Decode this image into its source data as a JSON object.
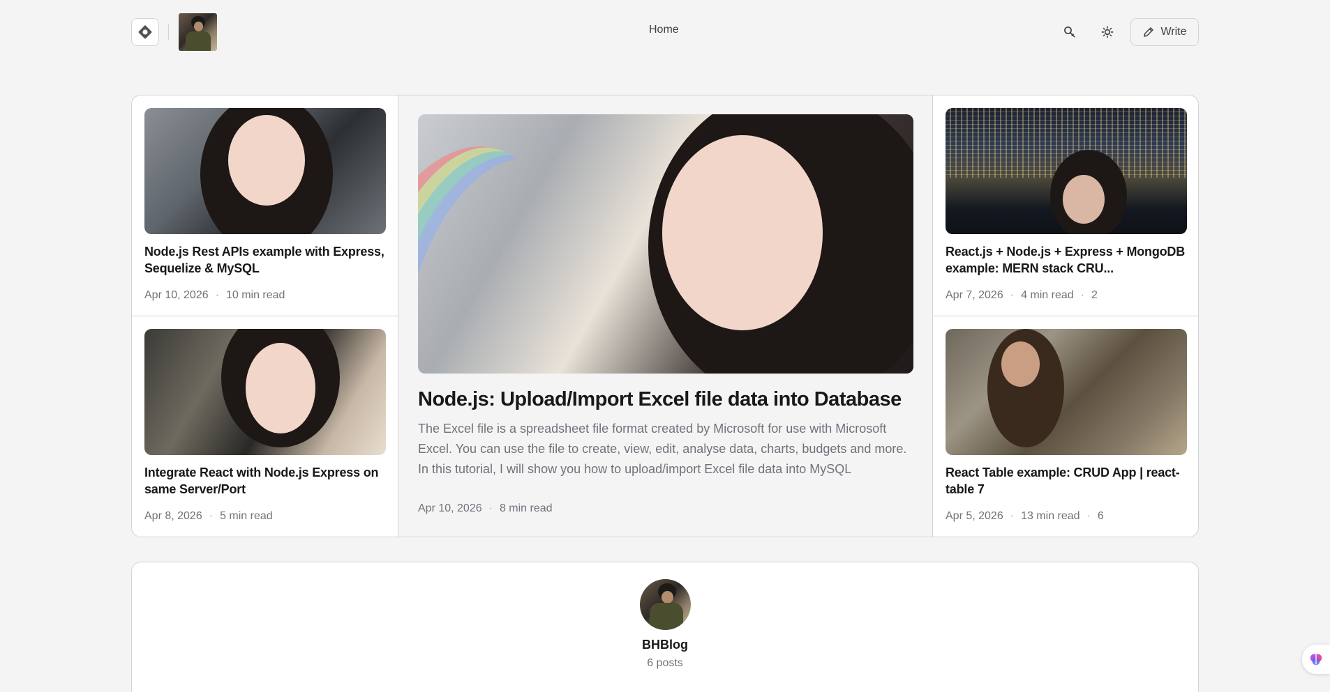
{
  "header": {
    "home_label": "Home",
    "write_label": "Write"
  },
  "featured": {
    "left": [
      {
        "title": "Node.js Rest APIs example with Express, Sequelize & MySQL",
        "date": "Apr 10, 2026",
        "read": "10 min read",
        "comments": ""
      },
      {
        "title": "Integrate React with Node.js Express on same Server/Port",
        "date": "Apr 8, 2026",
        "read": "5 min read",
        "comments": ""
      }
    ],
    "center": {
      "title": "Node.js: Upload/Import Excel file data into Database",
      "excerpt": "The Excel file is a spreadsheet file format created by Microsoft for use with Microsoft Excel. You can use the file to create, view, edit, analyse data, charts, budgets and more. In this tutorial, I will show you how to upload/import Excel file data into MySQL",
      "date": "Apr 10, 2026",
      "read": "8 min read"
    },
    "right": [
      {
        "title": "React.js + Node.js + Express + MongoDB example: MERN stack CRU...",
        "date": "Apr 7, 2026",
        "read": "4 min read",
        "comments": "2"
      },
      {
        "title": "React Table example: CRUD App | react-table 7",
        "date": "Apr 5, 2026",
        "read": "13 min read",
        "comments": "6"
      }
    ]
  },
  "profile": {
    "name": "BHBlog",
    "posts": "6 posts"
  },
  "dot": "·"
}
